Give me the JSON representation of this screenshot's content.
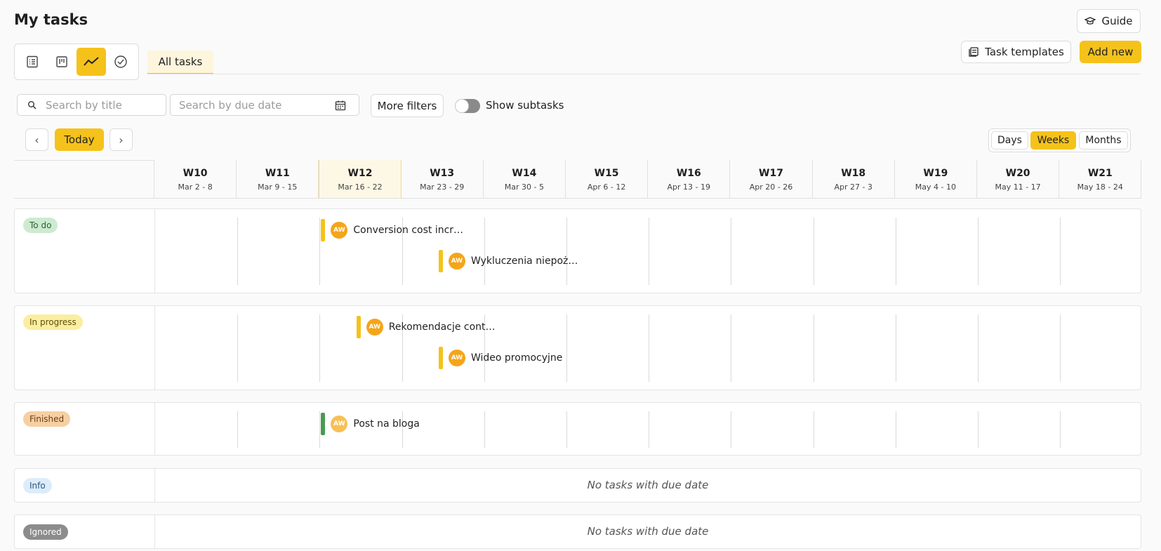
{
  "header": {
    "title": "My tasks",
    "guide_label": "Guide"
  },
  "actions": {
    "templates_label": "Task templates",
    "add_label": "Add new"
  },
  "views": [
    {
      "name": "list-view-icon",
      "active": false
    },
    {
      "name": "board-view-icon",
      "active": false
    },
    {
      "name": "timeline-view-icon",
      "active": true
    },
    {
      "name": "completed-view-icon",
      "active": false
    }
  ],
  "tabs": {
    "all_tasks": "All tasks"
  },
  "filters": {
    "search_title_placeholder": "Search by title",
    "search_date_placeholder": "Search by due date",
    "more_filters": "More filters",
    "show_subtasks": "Show subtasks",
    "show_subtasks_on": false
  },
  "nav": {
    "today": "Today",
    "prev": "‹",
    "next": "›"
  },
  "range": {
    "days": "Days",
    "weeks": "Weeks",
    "months": "Months",
    "selected": "Weeks"
  },
  "weeks": [
    {
      "num": "W10",
      "range": "Mar 2 - 8"
    },
    {
      "num": "W11",
      "range": "Mar 9 - 15"
    },
    {
      "num": "W12",
      "range": "Mar 16 - 22",
      "current": true
    },
    {
      "num": "W13",
      "range": "Mar 23 - 29"
    },
    {
      "num": "W14",
      "range": "Mar 30 - 5"
    },
    {
      "num": "W15",
      "range": "Apr 6 - 12"
    },
    {
      "num": "W16",
      "range": "Apr 13 - 19"
    },
    {
      "num": "W17",
      "range": "Apr 20 - 26"
    },
    {
      "num": "W18",
      "range": "Apr 27 - 3"
    },
    {
      "num": "W19",
      "range": "May 4 - 10"
    },
    {
      "num": "W20",
      "range": "May 11 - 17"
    },
    {
      "num": "W21",
      "range": "May 18 - 24"
    }
  ],
  "lanes": [
    {
      "status": "To do",
      "color": "#cdebd0",
      "text_color": "#2f5e33",
      "tasks": [
        {
          "initials": "AW",
          "title": "Conversion cost incr…",
          "bar_color": "#f5c21b"
        },
        {
          "initials": "AW",
          "title": "Wykluczenia niepoż…",
          "bar_color": "#f5c21b"
        }
      ]
    },
    {
      "status": "In progress",
      "color": "#fbeea0",
      "text_color": "#5c4d0a",
      "tasks": [
        {
          "initials": "AW",
          "title": "Rekomendacje cont…",
          "bar_color": "#f5c21b"
        },
        {
          "initials": "AW",
          "title": "Wideo promocyjne",
          "bar_color": "#f5c21b"
        }
      ]
    },
    {
      "status": "Finished",
      "color": "#f6cfa2",
      "text_color": "#6b3e10",
      "tasks": [
        {
          "initials": "AW",
          "title": "Post na bloga",
          "bar_color": "#4a9a4e"
        }
      ]
    },
    {
      "status": "Info",
      "color": "#dcecfb",
      "text_color": "#2a5680",
      "empty_text": "No tasks with due date"
    },
    {
      "status": "Ignored",
      "color": "#8c8c8c",
      "text_color": "#ffffff",
      "empty_text": "No tasks with due date"
    }
  ],
  "colors": {
    "accent": "#f5c21b",
    "done": "#4a9a4e"
  }
}
